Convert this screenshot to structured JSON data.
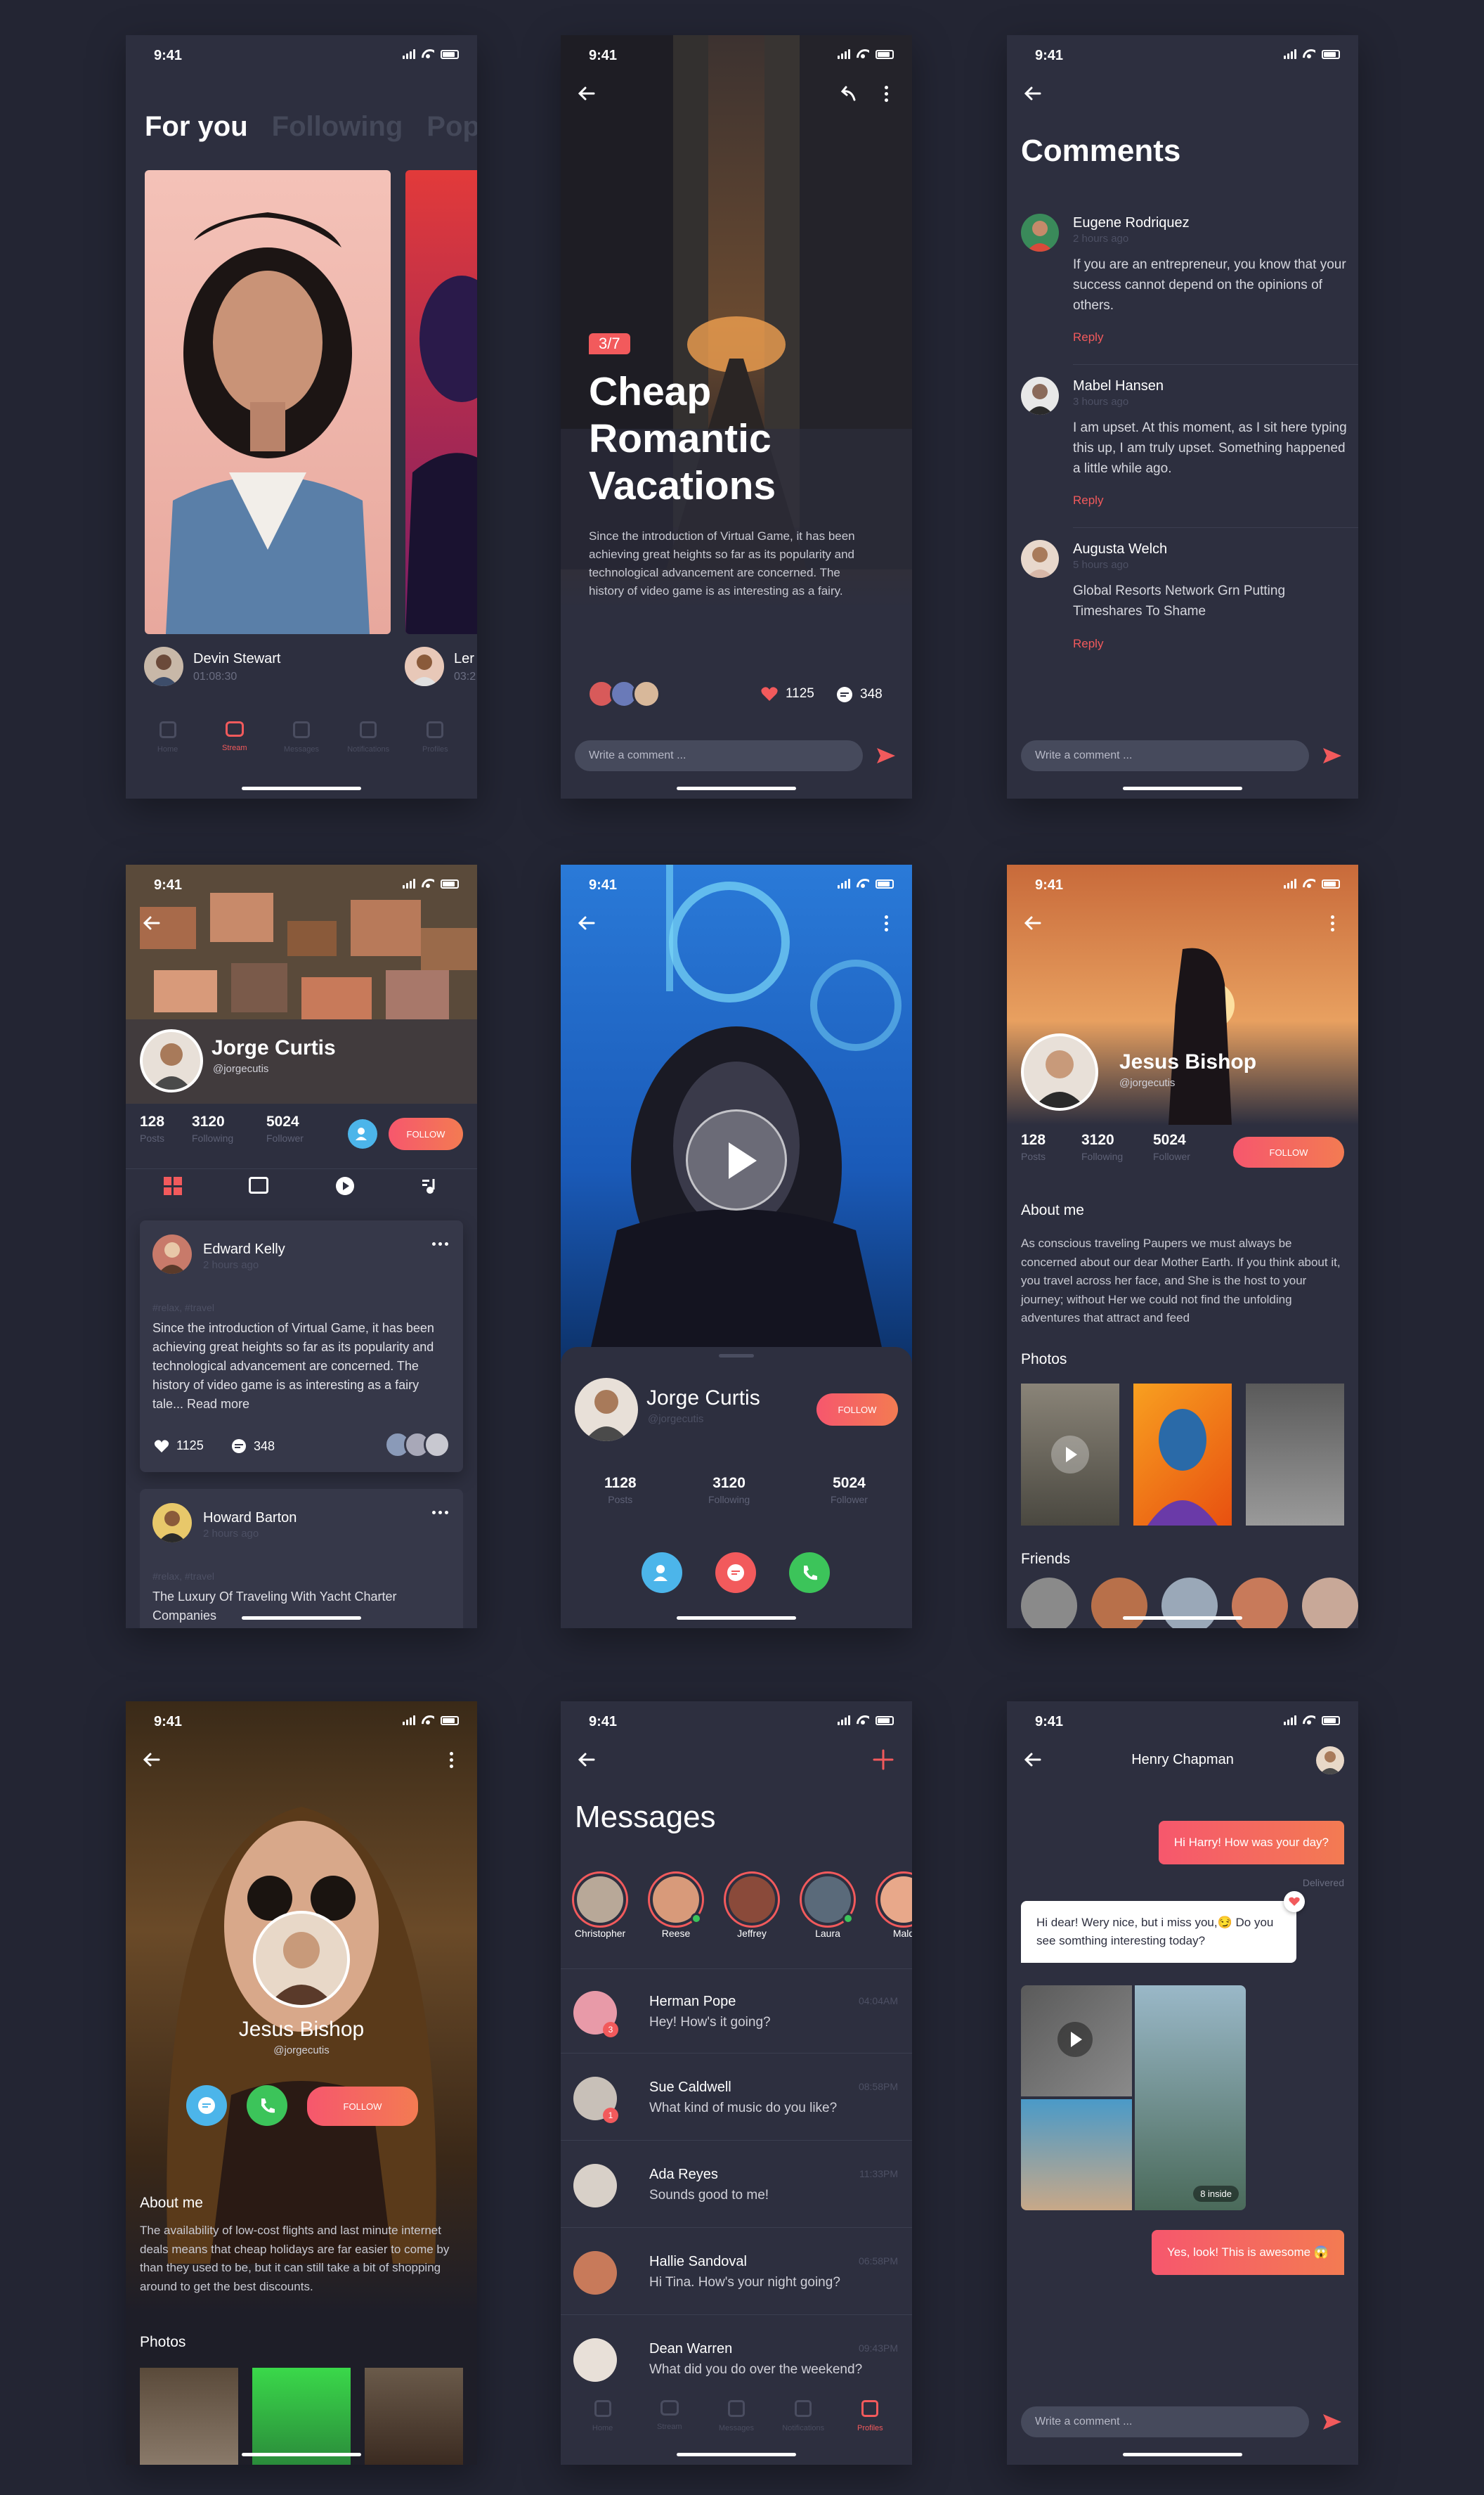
{
  "status": {
    "time": "9:41"
  },
  "p1": {
    "tabs": [
      "For you",
      "Following",
      "Pop"
    ],
    "user": {
      "name": "Devin Stewart",
      "time": "01:08:30"
    },
    "user2": {
      "name": "Ler",
      "time": "03:2"
    },
    "nav": [
      "Home",
      "Stream",
      "Messages",
      "Notifications",
      "Profiles"
    ]
  },
  "p2": {
    "counter": "3/7",
    "title": [
      "Cheap",
      "Romantic",
      "Vacations"
    ],
    "body": "Since the introduction of Virtual Game, it has been achieving great heights so far as its popularity and technological advancement are concerned. The history of video game is as interesting as a fairy.",
    "likes": "1125",
    "comments": "348",
    "comment_placeholder": "Write a comment ..."
  },
  "p3": {
    "title": "Comments",
    "items": [
      {
        "name": "Eugene Rodriquez",
        "time": "2 hours ago",
        "text": "If you are an entrepreneur, you know that your success cannot depend on the opinions of others.",
        "reply": "Reply"
      },
      {
        "name": "Mabel Hansen",
        "time": "3 hours ago",
        "text": "I am upset. At this moment, as I sit here typing this up, I am truly upset. Something happened a little while ago.",
        "reply": "Reply"
      },
      {
        "name": "Augusta Welch",
        "time": "5 hours ago",
        "text": "Global Resorts Network Grn Putting Timeshares To Shame",
        "reply": "Reply"
      }
    ],
    "comment_placeholder": "Write a comment ..."
  },
  "p4": {
    "name": "Jorge Curtis",
    "handle": "@jorgecutis",
    "stats": [
      {
        "v": "128",
        "l": "Posts"
      },
      {
        "v": "3120",
        "l": "Following"
      },
      {
        "v": "5024",
        "l": "Follower"
      }
    ],
    "follow": "FOLLOW",
    "posts": [
      {
        "name": "Edward Kelly",
        "time": "2 hours ago",
        "tags": "#relax, #travel",
        "text": "Since the introduction of Virtual Game, it has been achieving great heights so far as its popularity and technological advancement are concerned. The history of video game is as interesting as a fairy tale... Read more",
        "likes": "1125",
        "comments": "348"
      },
      {
        "name": "Howard Barton",
        "time": "2 hours ago",
        "tags": "#relax, #travel",
        "text": "The Luxury Of Traveling With Yacht Charter Companies"
      }
    ]
  },
  "p5": {
    "name": "Jorge Curtis",
    "handle": "@jorgecutis",
    "follow": "FOLLOW",
    "stats": [
      {
        "v": "1128",
        "l": "Posts"
      },
      {
        "v": "3120",
        "l": "Following"
      },
      {
        "v": "5024",
        "l": "Follower"
      }
    ]
  },
  "p6": {
    "name": "Jesus Bishop",
    "handle": "@jorgecutis",
    "stats": [
      {
        "v": "128",
        "l": "Posts"
      },
      {
        "v": "3120",
        "l": "Following"
      },
      {
        "v": "5024",
        "l": "Follower"
      }
    ],
    "follow": "FOLLOW",
    "about_title": "About me",
    "about": "As conscious traveling Paupers we must always be concerned about our dear Mother Earth. If you think about it, you travel across her face, and She is the host to your journey; without Her we could not find the unfolding adventures that attract and feed",
    "photos_title": "Photos",
    "friends_title": "Friends"
  },
  "p7": {
    "name": "Jesus Bishop",
    "handle": "@jorgecutis",
    "follow": "FOLLOW",
    "about_title": "About me",
    "about": "The availability of low-cost flights and last minute internet deals means that cheap holidays are far easier to come by than they used to be, but it can still take a bit of shopping around to get the best discounts.",
    "photos_title": "Photos"
  },
  "p8": {
    "title": "Messages",
    "stories": [
      "Christopher",
      "Reese",
      "Jeffrey",
      "Laura",
      "Mald"
    ],
    "messages": [
      {
        "name": "Herman Pope",
        "text": "Hey! How's it going?",
        "time": "04:04AM",
        "badge": "3"
      },
      {
        "name": "Sue Caldwell",
        "text": "What kind of music do you like?",
        "time": "08:58PM",
        "badge": "1"
      },
      {
        "name": "Ada Reyes",
        "text": "Sounds good to me!",
        "time": "11:33PM"
      },
      {
        "name": "Hallie Sandoval",
        "text": "Hi Tina. How's your night going?",
        "time": "06:58PM"
      },
      {
        "name": "Dean Warren",
        "text": "What did you do over the weekend?",
        "time": "09:43PM"
      }
    ],
    "nav": [
      "Home",
      "Stream",
      "Messages",
      "Notifications",
      "Profiles"
    ]
  },
  "p9": {
    "name": "Henry Chapman",
    "msg1": "Hi Harry! How was your day?",
    "delivered": "Delivered",
    "msg2": "Hi dear! Wery nice, but i miss you,😏 Do you see somthing interesting today?",
    "more": "8 inside",
    "msg3": "Yes, look! This is awesome 😱",
    "comment_placeholder": "Write a comment ..."
  },
  "colors": {
    "bg": "#232533",
    "card": "#2d2f3f",
    "accent": "#f25a5c",
    "blue": "#4cb5ea",
    "green": "#3cc45a"
  }
}
